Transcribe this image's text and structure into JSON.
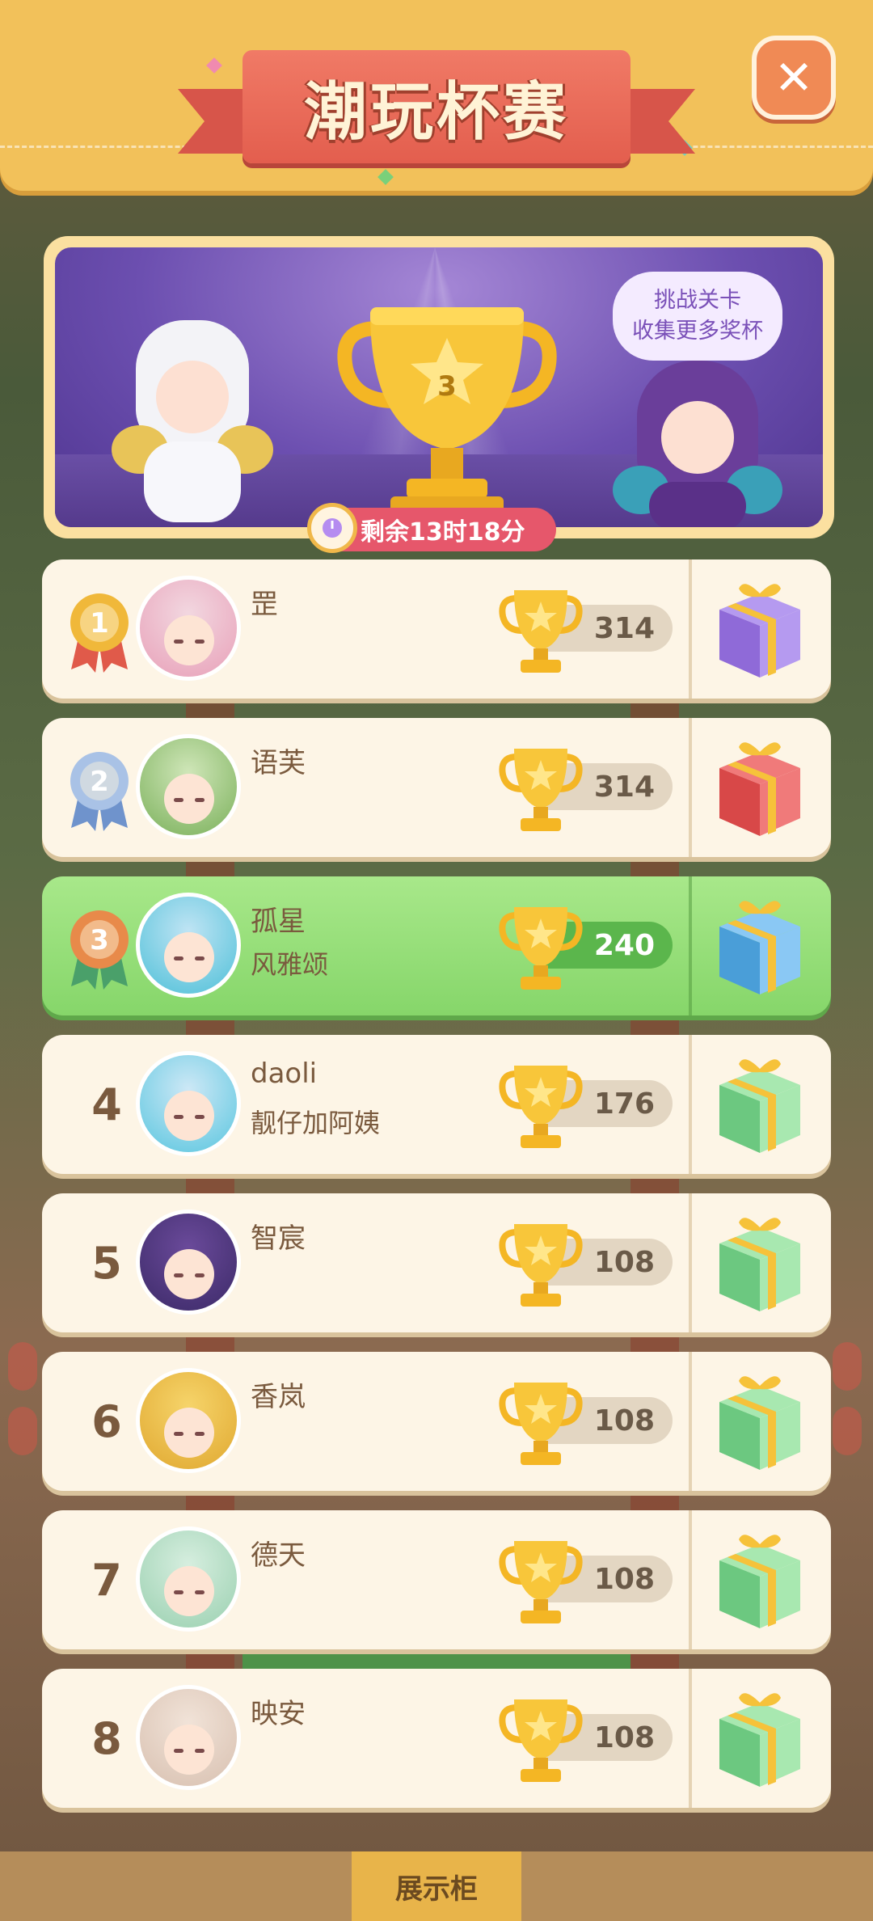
{
  "header": {
    "title": "潮玩杯赛",
    "close_icon": "close-icon"
  },
  "banner": {
    "cup_rank": "3",
    "speech_line1": "挑战关卡",
    "speech_line2": "收集更多奖杯",
    "timer": "剩余13时18分"
  },
  "ranking": [
    {
      "rank": "1",
      "name": "罡",
      "subtitle": "",
      "score": "314",
      "medal": "gold",
      "gift": "purple",
      "highlight": false
    },
    {
      "rank": "2",
      "name": "语芙",
      "subtitle": "",
      "score": "314",
      "medal": "silver",
      "gift": "red",
      "highlight": false
    },
    {
      "rank": "3",
      "name": "孤星",
      "subtitle": "风雅颂",
      "score": "240",
      "medal": "bronze",
      "gift": "blue",
      "highlight": true
    },
    {
      "rank": "4",
      "name": "daoli",
      "subtitle": "靓仔加阿姨",
      "score": "176",
      "medal": "",
      "gift": "green",
      "highlight": false
    },
    {
      "rank": "5",
      "name": "智宸",
      "subtitle": "",
      "score": "108",
      "medal": "",
      "gift": "green",
      "highlight": false
    },
    {
      "rank": "6",
      "name": "香岚",
      "subtitle": "",
      "score": "108",
      "medal": "",
      "gift": "green",
      "highlight": false
    },
    {
      "rank": "7",
      "name": "德天",
      "subtitle": "",
      "score": "108",
      "medal": "",
      "gift": "green",
      "highlight": false
    },
    {
      "rank": "8",
      "name": "映安",
      "subtitle": "",
      "score": "108",
      "medal": "",
      "gift": "green",
      "highlight": false
    }
  ],
  "bottom_nav": {
    "active_label": "展示柜"
  },
  "colors": {
    "header": "#f2c15a",
    "ribbon": "#e35e4e",
    "banner": "#6c4fb0",
    "highlight_row": "#86d66a"
  }
}
